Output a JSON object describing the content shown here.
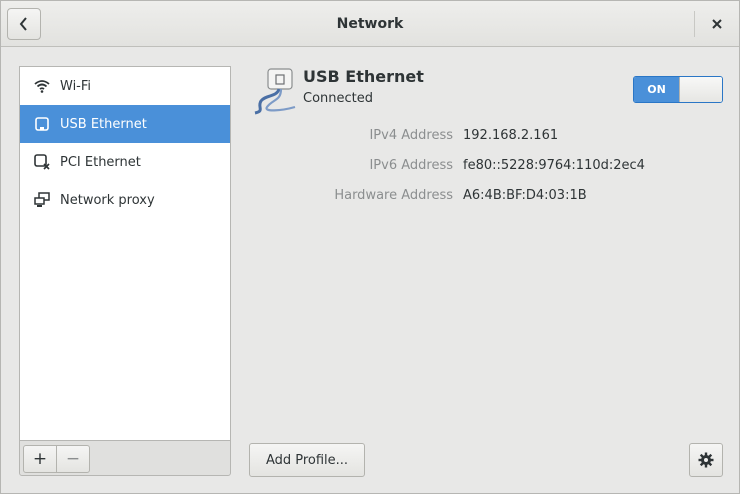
{
  "window": {
    "title": "Network"
  },
  "headerbar": {
    "back_icon": "chevron-left-icon",
    "close_label": "×"
  },
  "sidebar": {
    "items": [
      {
        "label": "Wi-Fi",
        "icon": "wifi-icon",
        "selected": false
      },
      {
        "label": "USB Ethernet",
        "icon": "wired-icon",
        "selected": true
      },
      {
        "label": "PCI Ethernet",
        "icon": "wired-disconnected-icon",
        "selected": false
      },
      {
        "label": "Network proxy",
        "icon": "proxy-icon",
        "selected": false
      }
    ],
    "add_label": "+",
    "remove_label": "−"
  },
  "device": {
    "name": "USB Ethernet",
    "status": "Connected",
    "switch_label": "ON",
    "switch_on": true,
    "icon": "ethernet-cable-icon"
  },
  "properties": [
    {
      "label": "IPv4 Address",
      "value": "192.168.2.161"
    },
    {
      "label": "IPv6 Address",
      "value": "fe80::5228:9764:110d:2ec4"
    },
    {
      "label": "Hardware Address",
      "value": "A6:4B:BF:D4:03:1B"
    }
  ],
  "footer": {
    "add_profile_label": "Add Profile...",
    "options_icon": "gear-icon"
  },
  "colors": {
    "accent": "#4a90d9",
    "dim_text": "#8b8e8f",
    "text": "#2e3436"
  }
}
